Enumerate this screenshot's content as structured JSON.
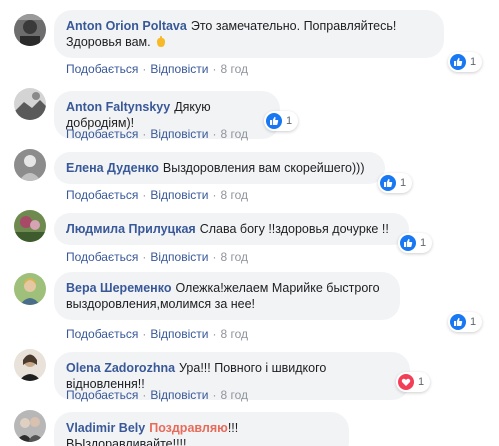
{
  "colors": {
    "like_blue": "#1877f2",
    "love_red": "#f33e58",
    "link_blue": "#385898",
    "bubble_bg": "#f2f3f5",
    "highlight": "#e86b5a"
  },
  "actions": {
    "like": "Подобається",
    "reply": "Відповісти",
    "dot": "·",
    "time": "8 год"
  },
  "comments": [
    {
      "author": "Anton Orion Poltava",
      "text": "Это замечательно. Поправляйтесь! Здоровья вам.",
      "emoji": "hand-emoji-icon",
      "reaction": "like",
      "count": "1"
    },
    {
      "author": "Anton Faltynskyy",
      "text": "Дякую добродіям)!",
      "reaction": "like",
      "count": "1"
    },
    {
      "author": "Елена Дуденко",
      "text": "Выздоровления вам скорейшего)))",
      "reaction": "like",
      "count": "1"
    },
    {
      "author": "Людмила Прилуцкая",
      "text": "Слава богу !!здоровья дочурке !!",
      "reaction": "like",
      "count": "1"
    },
    {
      "author": "Вера Шеременко",
      "text": "Олежка!желаем Марийке быстрого выздоровления,молимся за нее!",
      "reaction": "like",
      "count": "1"
    },
    {
      "author": "Olena Zadorozhna",
      "text": "Ура!!! Повного і швидкого відновлення!!",
      "reaction": "love",
      "count": "1"
    },
    {
      "author": "Vladimir Bely",
      "highlight": "Поздравляю",
      "text": "!!!ВЫздоравливайте!!!!"
    }
  ]
}
